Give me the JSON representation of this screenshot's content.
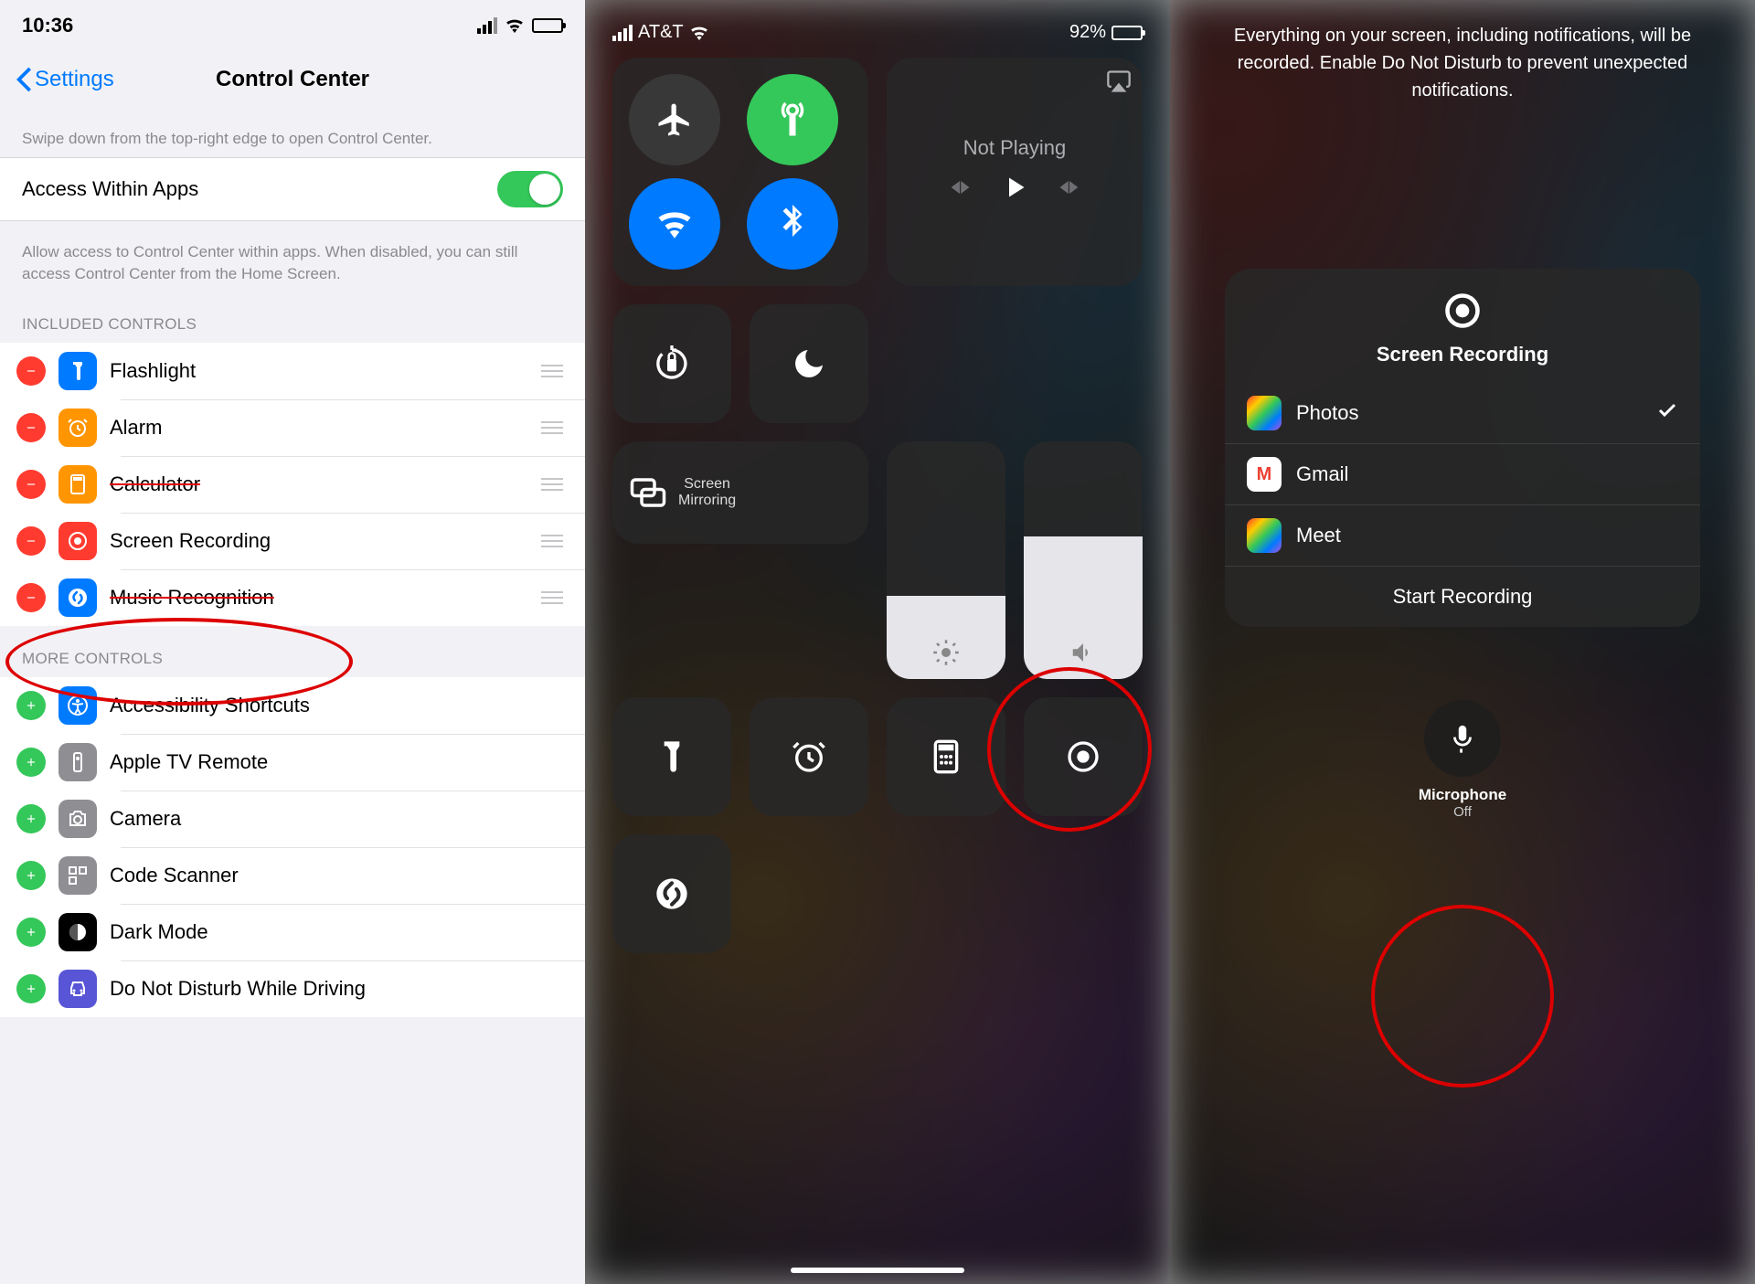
{
  "panel1": {
    "status": {
      "time": "10:36"
    },
    "nav": {
      "back": "Settings",
      "title": "Control Center"
    },
    "swipe_hint": "Swipe down from the top-right edge to open Control Center.",
    "access_label": "Access Within Apps",
    "access_footer": "Allow access to Control Center within apps. When disabled, you can still access Control Center from the Home Screen.",
    "included_header": "INCLUDED CONTROLS",
    "included": [
      {
        "label": "Flashlight",
        "icon": "flashlight",
        "color": "#007aff"
      },
      {
        "label": "Alarm",
        "icon": "alarm",
        "color": "#ff9500"
      },
      {
        "label": "Calculator",
        "icon": "calculator",
        "color": "#ff9500"
      },
      {
        "label": "Screen Recording",
        "icon": "record",
        "color": "#ff3b30"
      },
      {
        "label": "Music Recognition",
        "icon": "shazam",
        "color": "#007aff"
      }
    ],
    "more_header": "MORE CONTROLS",
    "more": [
      {
        "label": "Accessibility Shortcuts",
        "icon": "accessibility",
        "color": "#007aff"
      },
      {
        "label": "Apple TV Remote",
        "icon": "remote",
        "color": "#8e8e93"
      },
      {
        "label": "Camera",
        "icon": "camera",
        "color": "#8e8e93"
      },
      {
        "label": "Code Scanner",
        "icon": "qr",
        "color": "#8e8e93"
      },
      {
        "label": "Dark Mode",
        "icon": "darkmode",
        "color": "#000000"
      },
      {
        "label": "Do Not Disturb While Driving",
        "icon": "car",
        "color": "#5856d6"
      }
    ]
  },
  "panel2": {
    "status": {
      "carrier": "AT&T",
      "battery_pct": "92%"
    },
    "media_title": "Not Playing",
    "mirror_label": "Screen\nMirroring",
    "brightness_pct": 35,
    "volume_pct": 60
  },
  "panel3": {
    "info_text": "Everything on your screen, including notifications, will be recorded. Enable Do Not Disturb to prevent unexpected notifications.",
    "title": "Screen Recording",
    "apps": [
      {
        "label": "Photos",
        "selected": true,
        "ico": "photos"
      },
      {
        "label": "Gmail",
        "selected": false,
        "ico": "gmail"
      },
      {
        "label": "Meet",
        "selected": false,
        "ico": "meet"
      }
    ],
    "start_label": "Start Recording",
    "mic_label": "Microphone",
    "mic_state": "Off"
  }
}
